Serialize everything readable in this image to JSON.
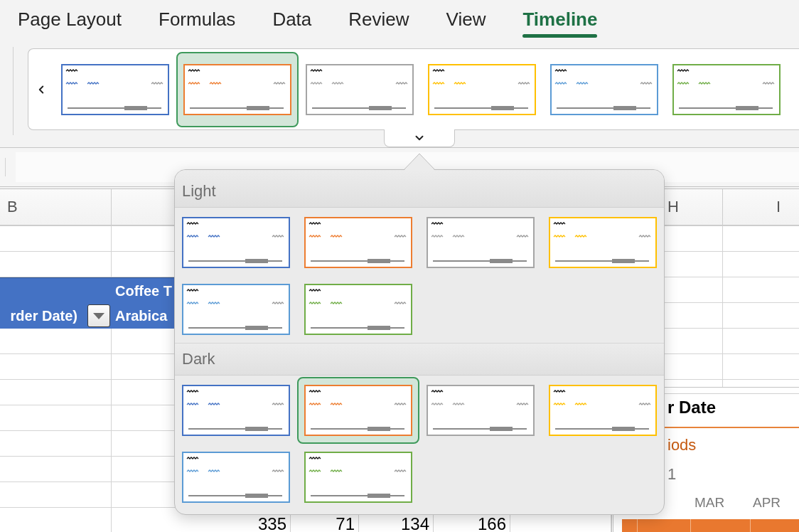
{
  "ribbon": {
    "tabs": [
      {
        "label": "Page Layout",
        "selected": false
      },
      {
        "label": "Formulas",
        "selected": false
      },
      {
        "label": "Data",
        "selected": false
      },
      {
        "label": "Review",
        "selected": false
      },
      {
        "label": "View",
        "selected": false
      },
      {
        "label": "Timeline",
        "selected": true
      }
    ]
  },
  "style_gallery": {
    "styles": [
      {
        "color": "#4472c4",
        "selected": false
      },
      {
        "color": "#ed7d31",
        "selected": true
      },
      {
        "color": "#a5a5a5",
        "selected": false
      },
      {
        "color": "#ffc000",
        "selected": false
      },
      {
        "color": "#5b9bd5",
        "selected": false
      },
      {
        "color": "#70ad47",
        "selected": false
      }
    ]
  },
  "style_popover": {
    "sections": [
      {
        "title": "Light",
        "styles": [
          {
            "color": "#4472c4",
            "selected": false
          },
          {
            "color": "#ed7d31",
            "selected": false
          },
          {
            "color": "#a5a5a5",
            "selected": false
          },
          {
            "color": "#ffc000",
            "selected": false
          },
          {
            "color": "#5b9bd5",
            "selected": false
          },
          {
            "color": "#70ad47",
            "selected": false
          }
        ]
      },
      {
        "title": "Dark",
        "styles": [
          {
            "color": "#4472c4",
            "selected": false
          },
          {
            "color": "#ed7d31",
            "selected": true
          },
          {
            "color": "#a5a5a5",
            "selected": false
          },
          {
            "color": "#ffc000",
            "selected": false
          },
          {
            "color": "#5b9bd5",
            "selected": false
          },
          {
            "color": "#70ad47",
            "selected": false
          }
        ]
      }
    ]
  },
  "sheet": {
    "column_headers": [
      "B",
      "H",
      "I"
    ],
    "pivot_table": {
      "column_header": "Coffee T",
      "row_header": "rder Date)",
      "column_items": [
        "Arabica"
      ]
    },
    "last_row": [
      "335",
      "71",
      "134",
      "166"
    ]
  },
  "timeline": {
    "title": "r Date",
    "period_label": "iods",
    "range_label": "1",
    "months": [
      "MAR",
      "APR"
    ]
  }
}
